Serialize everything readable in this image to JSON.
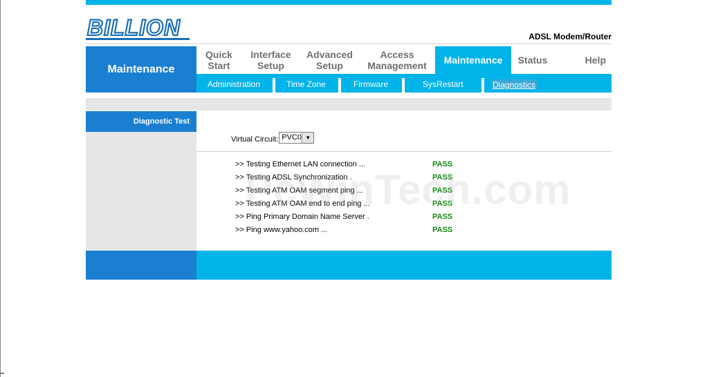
{
  "brand": {
    "logo_text": "BILLION",
    "product": "ADSL Modem/Router"
  },
  "section": {
    "title": "Maintenance"
  },
  "nav": [
    {
      "label_line1": "Quick",
      "label_line2": "Start"
    },
    {
      "label_line1": "Interface",
      "label_line2": "Setup"
    },
    {
      "label_line1": "Advanced",
      "label_line2": "Setup"
    },
    {
      "label_line1": "Access",
      "label_line2": "Management"
    },
    {
      "label_line1": "Maintenance",
      "label_line2": ""
    },
    {
      "label_line1": "Status",
      "label_line2": ""
    },
    {
      "label_line1": "Help",
      "label_line2": ""
    }
  ],
  "subnav": [
    "Administration",
    "Time Zone",
    "Firmware",
    "SysRestart",
    "Diagnostics"
  ],
  "left_tab": "Diagnostic Test",
  "virtual_circuit": {
    "label": "Virtual Circuit:",
    "value": "PVC0"
  },
  "tests": [
    {
      "label": ">> Testing Ethernet LAN connection ...",
      "result": "PASS"
    },
    {
      "label": ">> Testing ADSL Synchronization .",
      "result": "PASS"
    },
    {
      "label": ">> Testing ATM OAM segment ping ...",
      "result": "PASS"
    },
    {
      "label": ">> Testing ATM OAM end to end ping ...",
      "result": "PASS"
    },
    {
      "label": ">> Ping Primary Domain Name Server .",
      "result": "PASS"
    },
    {
      "label": ">> Ping www.yahoo.com ...",
      "result": "PASS"
    }
  ],
  "watermark": "PcWinTech.com",
  "colors": {
    "accent": "#00b3e8",
    "dark_blue": "#1b7fd1",
    "pass": "#118a11",
    "panel": "#e6e6e6"
  }
}
